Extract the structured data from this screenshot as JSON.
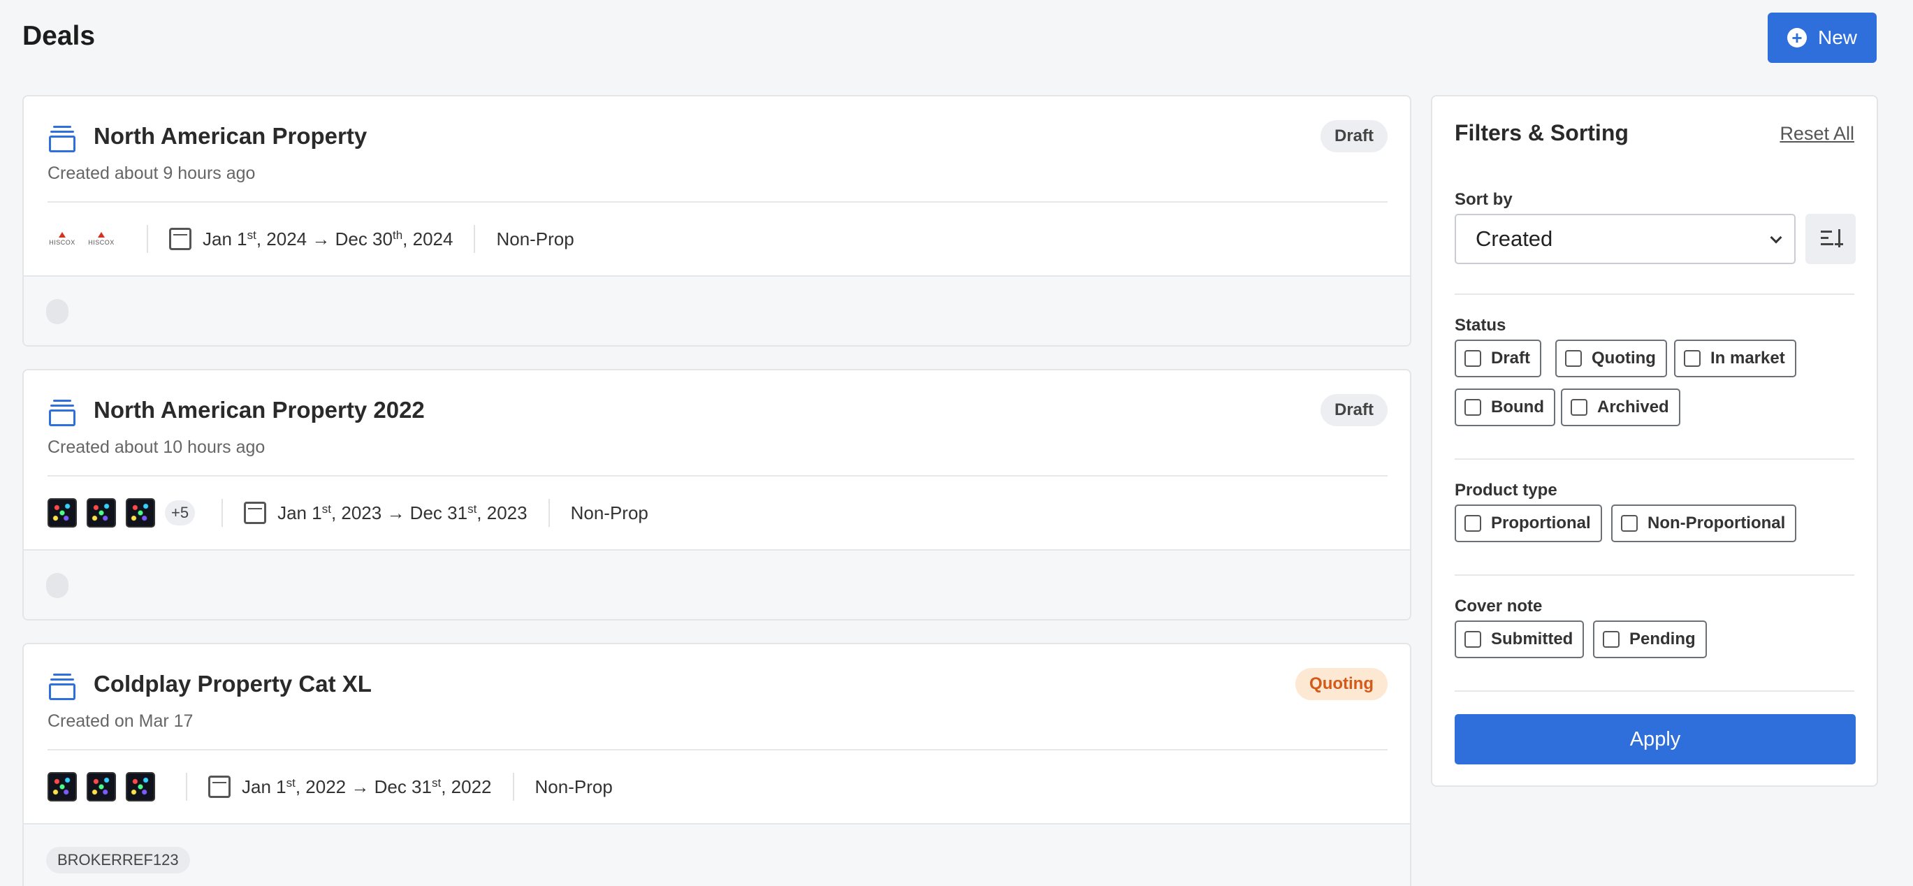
{
  "header": {
    "title": "Deals",
    "new_button_label": "New"
  },
  "deals": [
    {
      "title": "North American Property",
      "created": "Created about 9 hours ago",
      "status": "Draft",
      "logo_text": "HISCOX",
      "date_start_pre": "Jan 1",
      "date_start_sup": "st",
      "date_start_post": ", 2024 → Dec 30",
      "date_end_sup": "th",
      "date_end_post": ", 2024",
      "product": "Non-Prop"
    },
    {
      "title": "North American Property 2022",
      "created": "Created about 10 hours ago",
      "status": "Draft",
      "more_count": "+5",
      "date_start_pre": "Jan 1",
      "date_start_sup": "st",
      "date_start_post": ", 2023 → Dec 31",
      "date_end_sup": "st",
      "date_end_post": ", 2023",
      "product": "Non-Prop"
    },
    {
      "title": "Coldplay Property Cat XL",
      "created": "Created on Mar 17",
      "status": "Quoting",
      "date_start_pre": "Jan 1",
      "date_start_sup": "st",
      "date_start_post": ", 2022 → Dec 31",
      "date_end_sup": "st",
      "date_end_post": ", 2022",
      "product": "Non-Prop",
      "tag": "BROKERREF123"
    }
  ],
  "filters": {
    "title": "Filters & Sorting",
    "reset_label": "Reset All",
    "sort_label": "Sort by",
    "sort_value": "Created",
    "status_label": "Status",
    "status_options": [
      "Draft",
      "Quoting",
      "In market",
      "Bound",
      "Archived"
    ],
    "product_label": "Product type",
    "product_options": [
      "Proportional",
      "Non-Proportional"
    ],
    "cover_label": "Cover note",
    "cover_options": [
      "Submitted",
      "Pending"
    ],
    "apply_label": "Apply"
  },
  "colors": {
    "accent": "#2f6fdc",
    "quoting_badge_bg": "#fde8d3",
    "quoting_badge_text": "#d45a1a",
    "draft_badge_bg": "#eceef1"
  }
}
